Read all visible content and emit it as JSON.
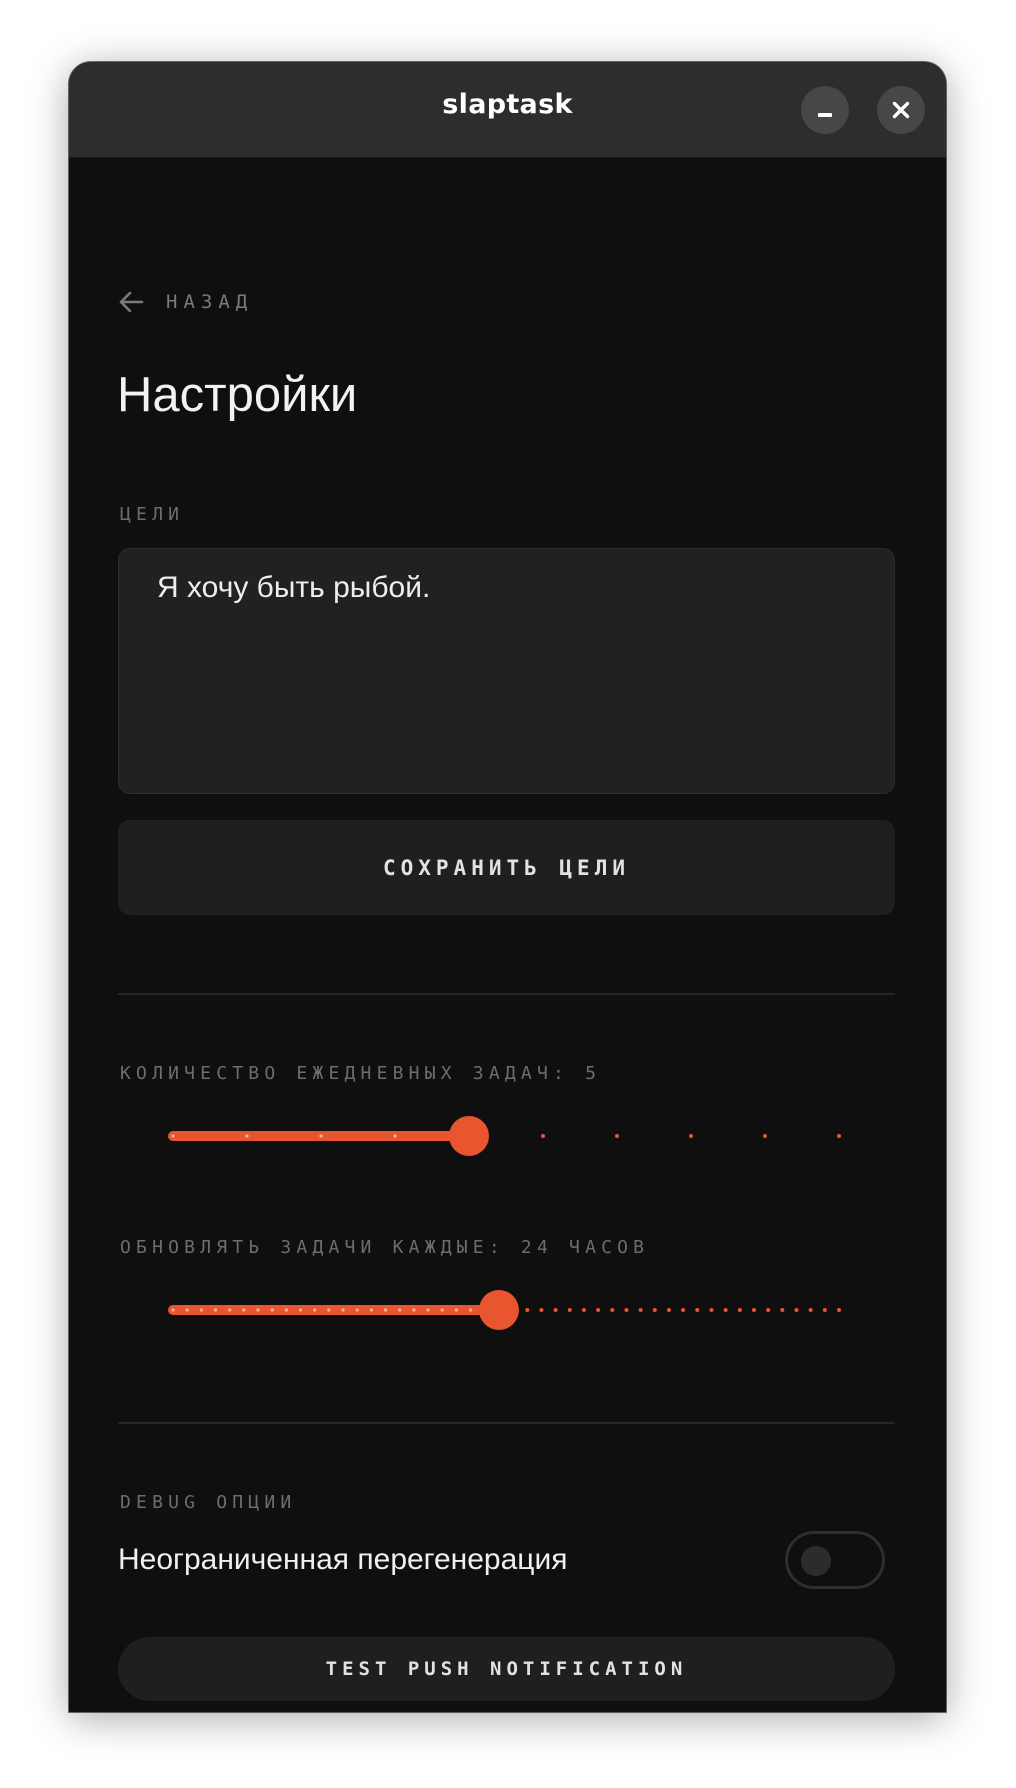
{
  "window": {
    "title": "slaptask"
  },
  "nav": {
    "back_label": "НАЗАД"
  },
  "page": {
    "title": "Настройки"
  },
  "goals": {
    "section_label": "ЦЕЛИ",
    "value": "Я хочу быть рыбой.",
    "save_label": "СОХРАНИТЬ ЦЕЛИ"
  },
  "daily_tasks": {
    "label": "КОЛИЧЕСТВО ЕЖЕДНЕВНЫХ ЗАДАЧ: 5",
    "min": 1,
    "max": 10,
    "step": 1,
    "value": 5
  },
  "refresh_interval": {
    "label": "ОБНОВЛЯТЬ ЗАДАЧИ КАЖДЫЕ: 24 ЧАСОВ",
    "min": 1,
    "max": 48,
    "step": 1,
    "value": 24
  },
  "debug": {
    "section_label": "DEBUG ОПЦИИ",
    "unlimited_regen_label": "Неограниченная перегенерация",
    "unlimited_regen_enabled": false,
    "push_test_label": "TEST PUSH NOTIFICATION"
  },
  "colors": {
    "accent": "#e8552e",
    "background": "#0f0f0f",
    "titlebar": "#2d2d2d",
    "surface": "#212121"
  },
  "icons": {
    "back": "arrow-left-icon",
    "minimize": "minimize-icon",
    "close": "close-icon"
  }
}
